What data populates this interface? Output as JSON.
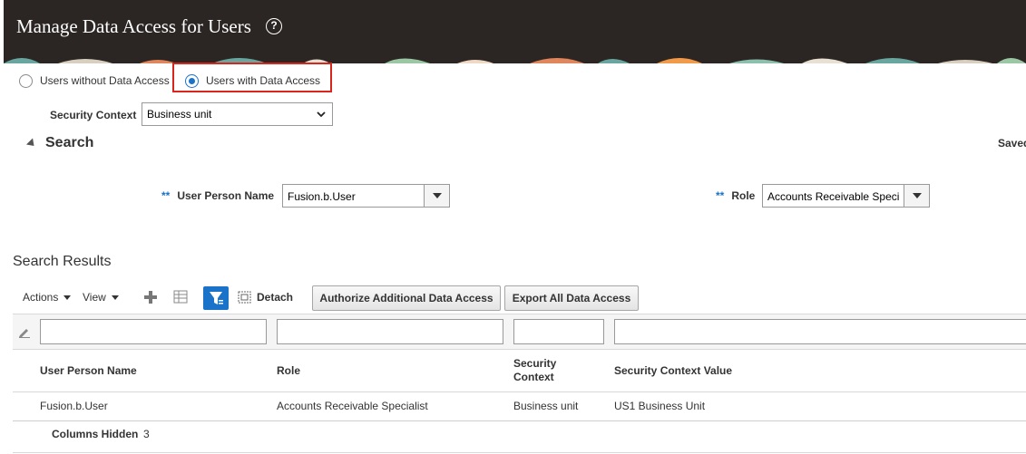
{
  "header": {
    "title": "Manage Data Access for Users",
    "help_icon": "question-circle-icon"
  },
  "mode": {
    "options": [
      "Users without Data Access",
      "Users with Data Access"
    ],
    "selected": "Users with Data Access"
  },
  "security_context": {
    "label": "Security Context",
    "value": "Business unit"
  },
  "search": {
    "title": "Search",
    "saved_label": "Saved",
    "required_marker": "**",
    "user_person_name": {
      "label": "User Person Name",
      "value": "Fusion.b.User"
    },
    "role": {
      "label": "Role",
      "value": "Accounts Receivable Speci"
    }
  },
  "results": {
    "title": "Search Results",
    "toolbar": {
      "actions": "Actions",
      "view": "View",
      "detach": "Detach",
      "authorize": "Authorize Additional Data Access",
      "export": "Export All Data Access"
    },
    "columns": [
      "User Person Name",
      "Role",
      "Security Context",
      "Security Context Value"
    ],
    "rows": [
      [
        "Fusion.b.User",
        "Accounts Receivable Specialist",
        "Business unit",
        "US1 Business Unit"
      ]
    ],
    "columns_hidden_label": "Columns Hidden",
    "columns_hidden_count": "3"
  },
  "colors": {
    "header_bg": "#2b2623",
    "accent": "#1a73c8",
    "highlight": "#d9261c"
  }
}
